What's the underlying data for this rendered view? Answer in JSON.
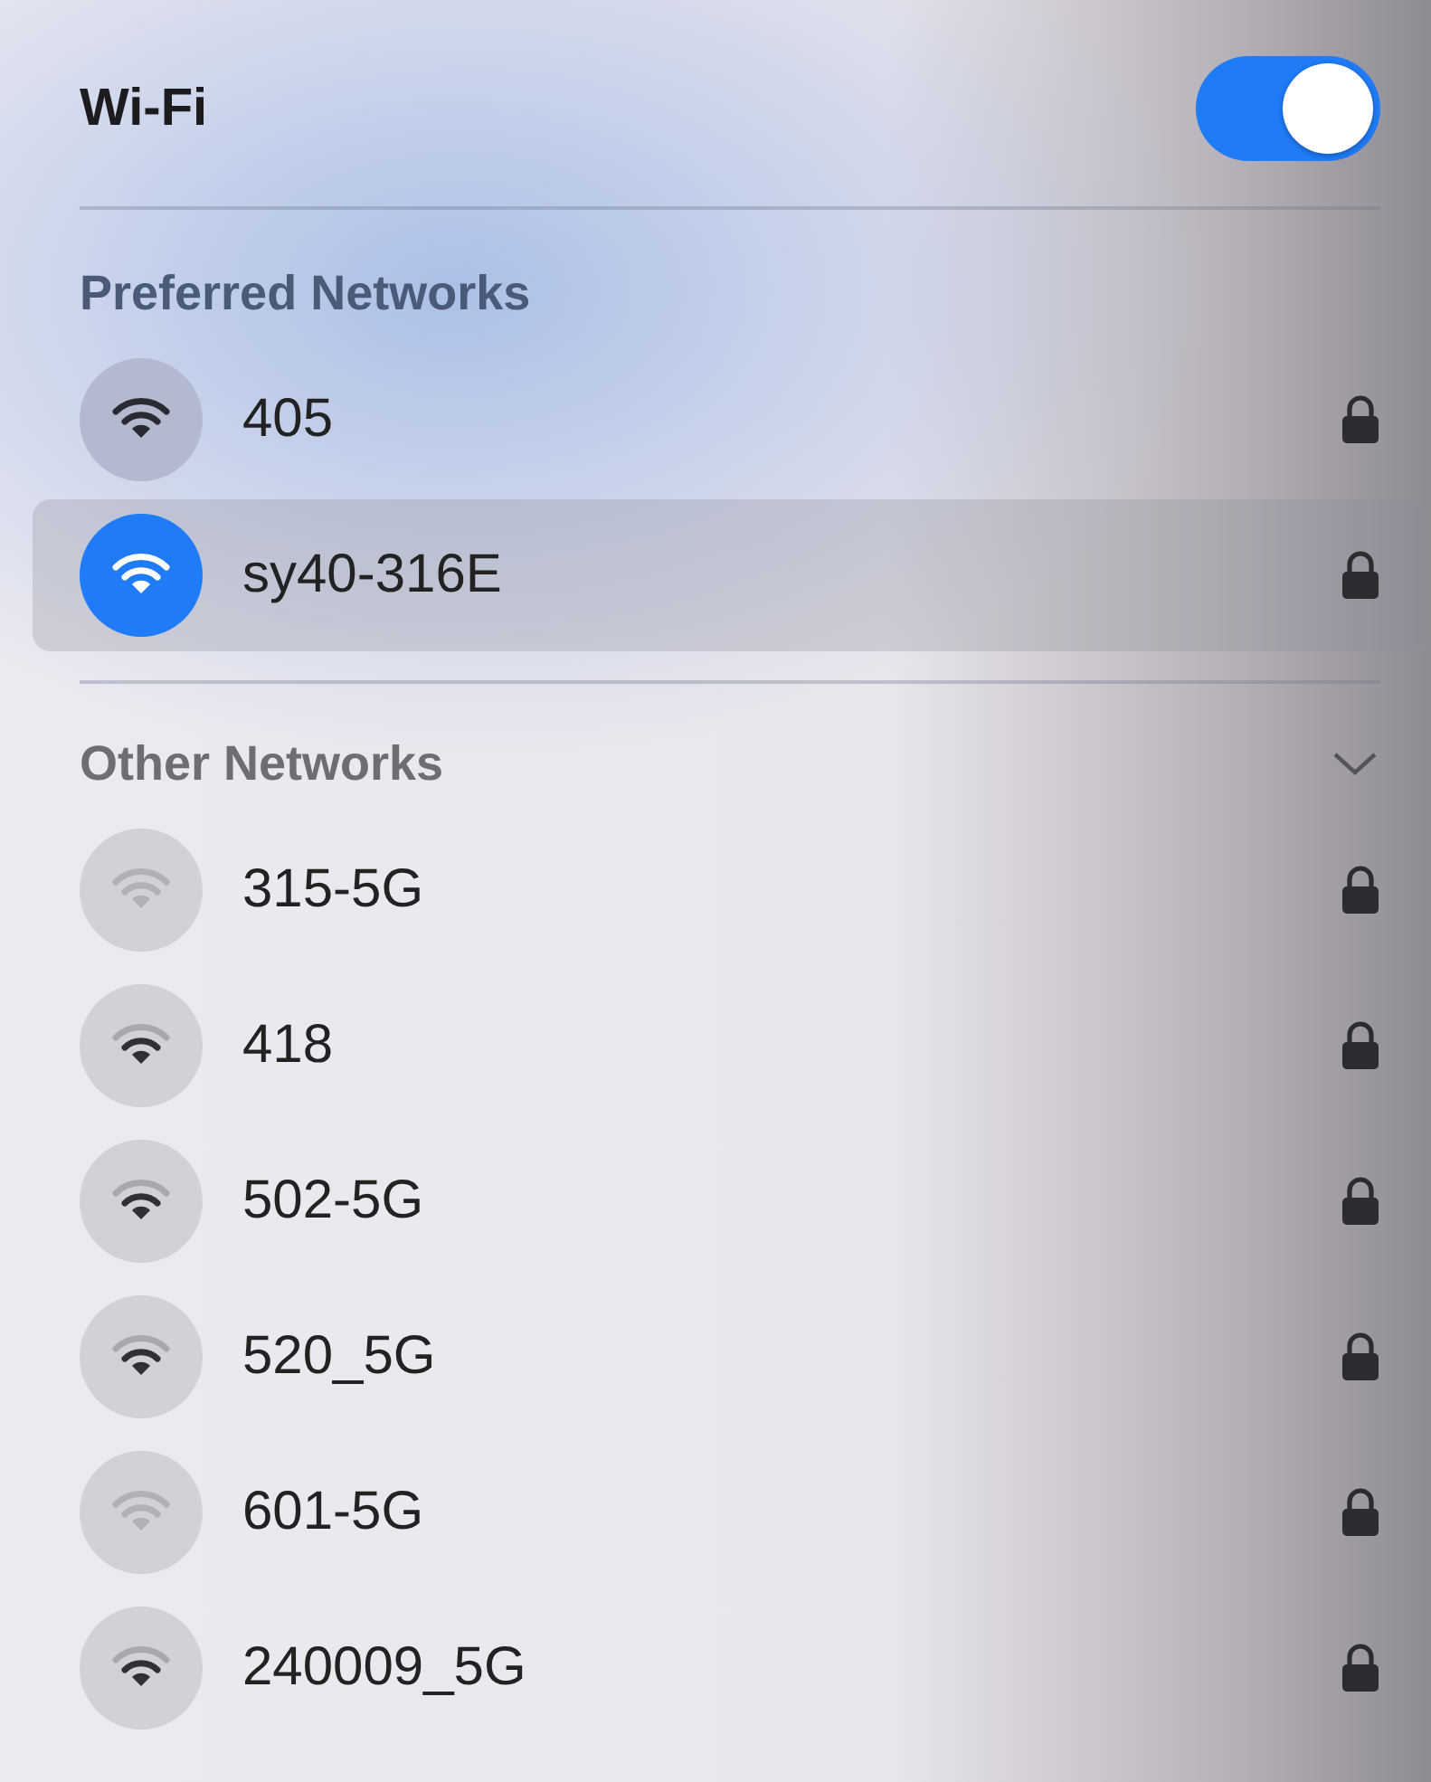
{
  "header": {
    "title": "Wi-Fi",
    "on": true
  },
  "preferred": {
    "title": "Preferred Networks",
    "networks": [
      {
        "name": "405",
        "kind": "full",
        "locked": true,
        "selected": false
      },
      {
        "name": "sy40-316E",
        "kind": "full",
        "locked": true,
        "selected": true
      }
    ]
  },
  "other": {
    "title": "Other Networks",
    "expanded": true,
    "networks": [
      {
        "name": "315-5G",
        "kind": "weak",
        "locked": true,
        "selected": false
      },
      {
        "name": "418",
        "kind": "medium",
        "locked": true,
        "selected": false
      },
      {
        "name": "502-5G",
        "kind": "medium",
        "locked": true,
        "selected": false
      },
      {
        "name": "520_5G",
        "kind": "medium",
        "locked": true,
        "selected": false
      },
      {
        "name": "601-5G",
        "kind": "weak",
        "locked": true,
        "selected": false
      },
      {
        "name": "240009_5G",
        "kind": "medium",
        "locked": true,
        "selected": false
      }
    ]
  }
}
